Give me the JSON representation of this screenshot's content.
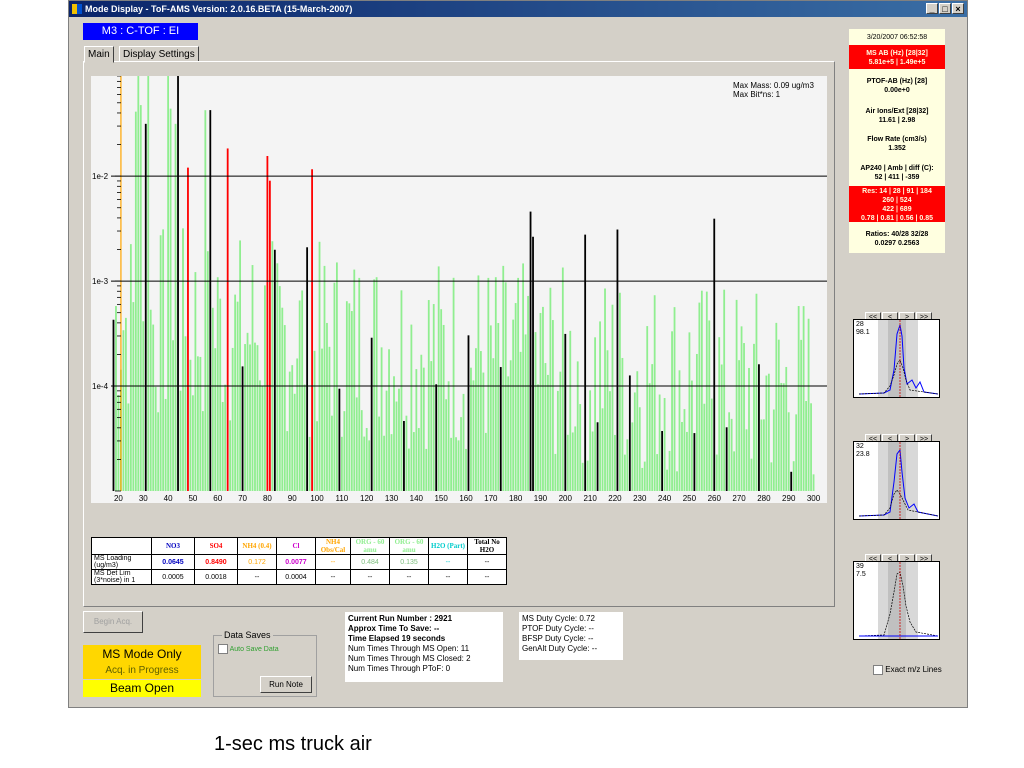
{
  "window": {
    "title": "Mode Display - ToF-AMS Version: 2.0.16.BETA (15-March-2007)",
    "min": "_",
    "max": "□",
    "close": "×"
  },
  "mode_title": "M3 : C-TOF : EI",
  "tabs": [
    "Main",
    "Display Settings"
  ],
  "plot": {
    "annotation_line1": "Max Mass: 0.09 ug/m3",
    "annotation_line2": "Max Bit*ns: 1",
    "colors": {
      "green": "#90ee90",
      "red": "#ff0000",
      "black": "#000000",
      "orange": "#ffa500",
      "background": "#f4f4f4"
    }
  },
  "chart_data": {
    "type": "bar",
    "x_ticks": [
      20,
      30,
      40,
      50,
      60,
      70,
      80,
      90,
      100,
      110,
      120,
      130,
      140,
      150,
      160,
      170,
      180,
      190,
      200,
      210,
      220,
      230,
      240,
      250,
      260,
      270,
      280,
      290,
      300
    ],
    "y_ticks": [
      "1e-2",
      "1e-3",
      "1e-4"
    ],
    "xlim": [
      17,
      303
    ],
    "ylim": [
      1e-05,
      0.09
    ],
    "y_scale": "log",
    "grid": "horizontal at decades"
  },
  "results": {
    "headers": [
      {
        "text": "NO3",
        "color": "#0000c0"
      },
      {
        "text": "SO4",
        "color": "#ff0000"
      },
      {
        "text": "NH4 (0.4)",
        "color": "#ffa500"
      },
      {
        "text": "Cl",
        "color": "#cc00cc"
      },
      {
        "text": "NH4 Obs/Cal",
        "color": "#ffa500"
      },
      {
        "text": "ORG - 60 amu",
        "color": "#90ee90"
      },
      {
        "text": "ORG - 60 amu",
        "color": "#90ee90"
      },
      {
        "text": "H2O (Part)",
        "color": "#00cccc"
      },
      {
        "text": "Total No H2O",
        "color": "#000000"
      }
    ],
    "rows": [
      {
        "label": "MS Loading (ug/m3)",
        "values": [
          "0.0645",
          "0.8490",
          "0.172",
          "0.0077",
          "--",
          "0.484",
          "0.135",
          "--",
          "--"
        ]
      },
      {
        "label": "MS Det Lim (3*noise) in 1",
        "values": [
          "0.0005",
          "0.0018",
          "--",
          "0.0004",
          "--",
          "--",
          "--",
          "--",
          "--"
        ]
      }
    ]
  },
  "begin_acq": "Begin Acq.",
  "data_saves": {
    "title": "Data Saves",
    "auto_save": "Auto Save Data",
    "run_note": "Run Note"
  },
  "status": {
    "mode": "MS Mode Only",
    "acq": "Acq. in Progress",
    "beam": "Beam Open"
  },
  "run_info": {
    "run_number": "Current Run Number : 2921",
    "approx_time": "Approx Time To Save: --",
    "time_elapsed": "Time Elapsed 19 seconds",
    "ms_open": "Num Times Through MS Open: 11",
    "ms_closed": "Num Times Through MS Closed: 2",
    "ptof": "Num Times Through PToF: 0"
  },
  "duty": {
    "ms": "MS Duty Cycle: 0.72",
    "ptof": "PTOF Duty Cycle: --",
    "bfsp": "BFSP Duty Cycle: --",
    "genalt": "GenAlt Duty Cycle: --"
  },
  "sidebar": {
    "timestamp": "3/20/2007 06:52:58",
    "ms_ab_label": "MS AB (Hz) [28|32]",
    "ms_ab_value": "5.81e+5 | 1.49e+5",
    "ptof_ab_label": "PTOF-AB (Hz) [28]",
    "ptof_ab_value": "0.00e+0",
    "air_ions_label": "Air Ions/Ext [28|32]",
    "air_ions_value": "11.61 | 2.98",
    "flow_label": "Flow Rate (cm3/s)",
    "flow_value": "1.352",
    "ap_label": "AP240 | Amb | diff (C):",
    "ap_value": "52 | 411 | -359",
    "res_line1": "Res: 14 | 28 | 91 | 184",
    "res_line2": "260 | 524",
    "res_line3": "422 | 689",
    "res_line4": "0.78 | 0.81 | 0.56 | 0.85",
    "ratios_label": "Ratios: 40/28 32/28",
    "ratios_value": "0.0297 0.2563"
  },
  "peaks": [
    {
      "mz": "28",
      "val": "98.1"
    },
    {
      "mz": "32",
      "val": "23.8"
    },
    {
      "mz": "39",
      "val": "7.5"
    }
  ],
  "peak_nav": [
    "<<",
    "<",
    ">",
    ">>"
  ],
  "exact_lines": "Exact m/z Lines",
  "caption": "1-sec ms truck air"
}
